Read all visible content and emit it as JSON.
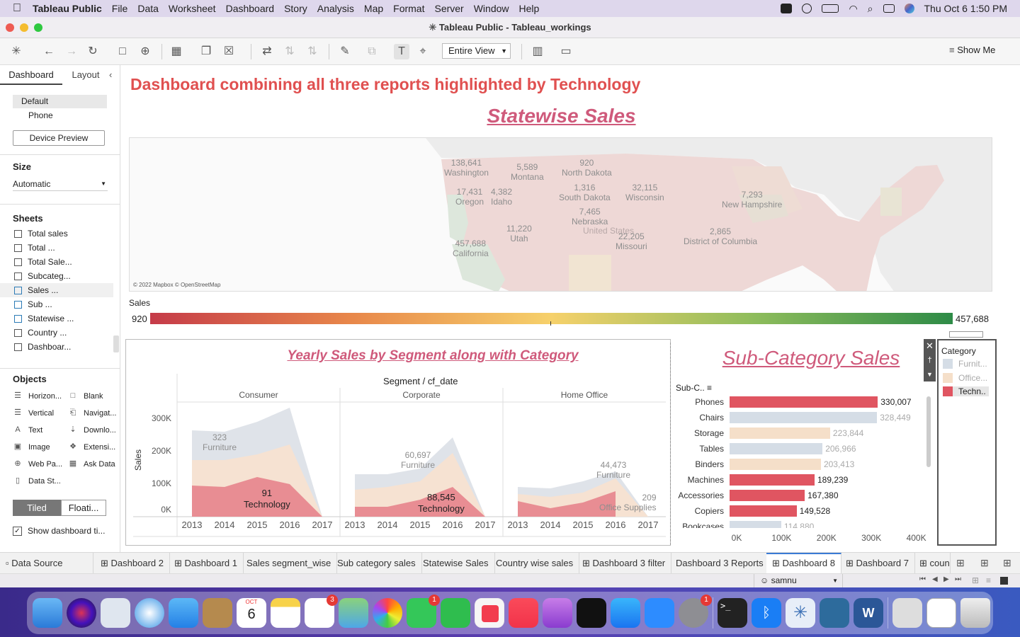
{
  "menubar": {
    "app": "Tableau Public",
    "items": [
      "File",
      "Data",
      "Worksheet",
      "Dashboard",
      "Story",
      "Analysis",
      "Map",
      "Format",
      "Server",
      "Window",
      "Help"
    ],
    "clock": "Thu Oct 6  1:50 PM"
  },
  "window": {
    "title": "Tableau Public - Tableau_workings"
  },
  "toolbar": {
    "view_select": "Entire View",
    "show_me": "Show Me"
  },
  "sidebar": {
    "tabs": [
      "Dashboard",
      "Layout"
    ],
    "device": {
      "default": "Default",
      "phone": "Phone",
      "preview_button": "Device Preview"
    },
    "size": {
      "heading": "Size",
      "value": "Automatic"
    },
    "sheets": {
      "heading": "Sheets",
      "items": [
        "Total sales",
        "Total ...",
        "Total Sale...",
        "Subcateg...",
        "Sales ...",
        "Sub ...",
        "Statewise ...",
        "Country ...",
        "Dashboar..."
      ]
    },
    "objects": {
      "heading": "Objects",
      "items": [
        [
          "Horizon...",
          "Blank"
        ],
        [
          "Vertical",
          "Navigat..."
        ],
        [
          "Text",
          "Downlo..."
        ],
        [
          "Image",
          "Extensi..."
        ],
        [
          "Web Pa...",
          "Ask Data"
        ],
        [
          "Data St...",
          ""
        ]
      ]
    },
    "layout_toggle": {
      "tiled": "Tiled",
      "floating": "Floati..."
    },
    "show_title": "Show dashboard ti..."
  },
  "dashboard": {
    "title": "Dashboard combining all three reports highlighted by Technology",
    "map": {
      "title": "Statewise Sales",
      "attribution": "© 2022 Mapbox © OpenStreetMap",
      "labels": [
        {
          "state": "Washington",
          "value": "138,641"
        },
        {
          "state": "Montana",
          "value": "5,589"
        },
        {
          "state": "North Dakota",
          "value": "920"
        },
        {
          "state": "Oregon",
          "value": "17,431"
        },
        {
          "state": "Idaho",
          "value": "4,382"
        },
        {
          "state": "South Dakota",
          "value": "1,316"
        },
        {
          "state": "Wisconsin",
          "value": "32,115"
        },
        {
          "state": "New Hampshire",
          "value": "7,293"
        },
        {
          "state": "Nebraska",
          "value": "7,465"
        },
        {
          "state": "United States",
          "value": ""
        },
        {
          "state": "Utah",
          "value": "11,220"
        },
        {
          "state": "California",
          "value": "457,688"
        },
        {
          "state": "Missouri",
          "value": "22,205"
        },
        {
          "state": "District of Columbia",
          "value": "2,865"
        }
      ],
      "legend": {
        "label": "Sales",
        "min": "920",
        "max": "457,688",
        "colors": [
          "#c53b49",
          "#e8874a",
          "#f6d16b",
          "#8fbd5c",
          "#2e8b47"
        ]
      }
    },
    "yearly": {
      "title": "Yearly Sales by Segment along with Category",
      "header": "Segment / cf_date",
      "ylabel": "Sales",
      "yticks": [
        "300K",
        "200K",
        "100K",
        "0K"
      ],
      "segments": [
        "Consumer",
        "Corporate",
        "Home Office"
      ],
      "years": [
        "2013",
        "2014",
        "2015",
        "2016",
        "2017"
      ],
      "annotations": [
        {
          "value": "323",
          "label": "Furniture"
        },
        {
          "value": "91",
          "label": "Technology"
        },
        {
          "value": "60,697",
          "label": "Furniture"
        },
        {
          "value": "88,545",
          "label": "Technology"
        },
        {
          "value": "44,473",
          "label": "Furniture"
        },
        {
          "value": "209",
          "label": "Office Supplies"
        }
      ]
    },
    "subcat": {
      "title": "Sub-Category Sales",
      "header": "Sub-C..",
      "xticks": [
        "0K",
        "100K",
        "200K",
        "300K",
        "400K"
      ],
      "bars": [
        {
          "name": "Phones",
          "value": "330,007",
          "cat": "Technology"
        },
        {
          "name": "Chairs",
          "value": "328,449",
          "cat": "Furniture"
        },
        {
          "name": "Storage",
          "value": "223,844",
          "cat": "Office Supplies"
        },
        {
          "name": "Tables",
          "value": "206,966",
          "cat": "Furniture"
        },
        {
          "name": "Binders",
          "value": "203,413",
          "cat": "Office Supplies"
        },
        {
          "name": "Machines",
          "value": "189,239",
          "cat": "Technology"
        },
        {
          "name": "Accessories",
          "value": "167,380",
          "cat": "Technology"
        },
        {
          "name": "Copiers",
          "value": "149,528",
          "cat": "Technology"
        },
        {
          "name": "Bookcases",
          "value": "114,880",
          "cat": "Furniture"
        }
      ]
    },
    "category_legend": {
      "heading": "Category",
      "items": [
        "Furnit...",
        "Office...",
        "Techn.."
      ]
    }
  },
  "colors": {
    "technology": "#e05561",
    "furniture": "#d5dde6",
    "office": "#f5dfc9",
    "title_red": "#e05050",
    "pink": "#cf5a7b"
  },
  "bottom_tabs": [
    "Data Source",
    "Dashboard 2",
    "Dashboard 1",
    "Sales segment_wise",
    "Sub category sales",
    "Statewise Sales",
    "Country wise sales",
    "Dashboard 3 filter",
    "Dashboard 3 Reports",
    "Dashboard 8",
    "Dashboard 7",
    "coun"
  ],
  "status": {
    "user": "samnu"
  },
  "dock": {
    "calendar_month": "OCT",
    "calendar_day": "6",
    "badges": {
      "reminders": "3",
      "messages": "1",
      "settings": "1"
    }
  }
}
